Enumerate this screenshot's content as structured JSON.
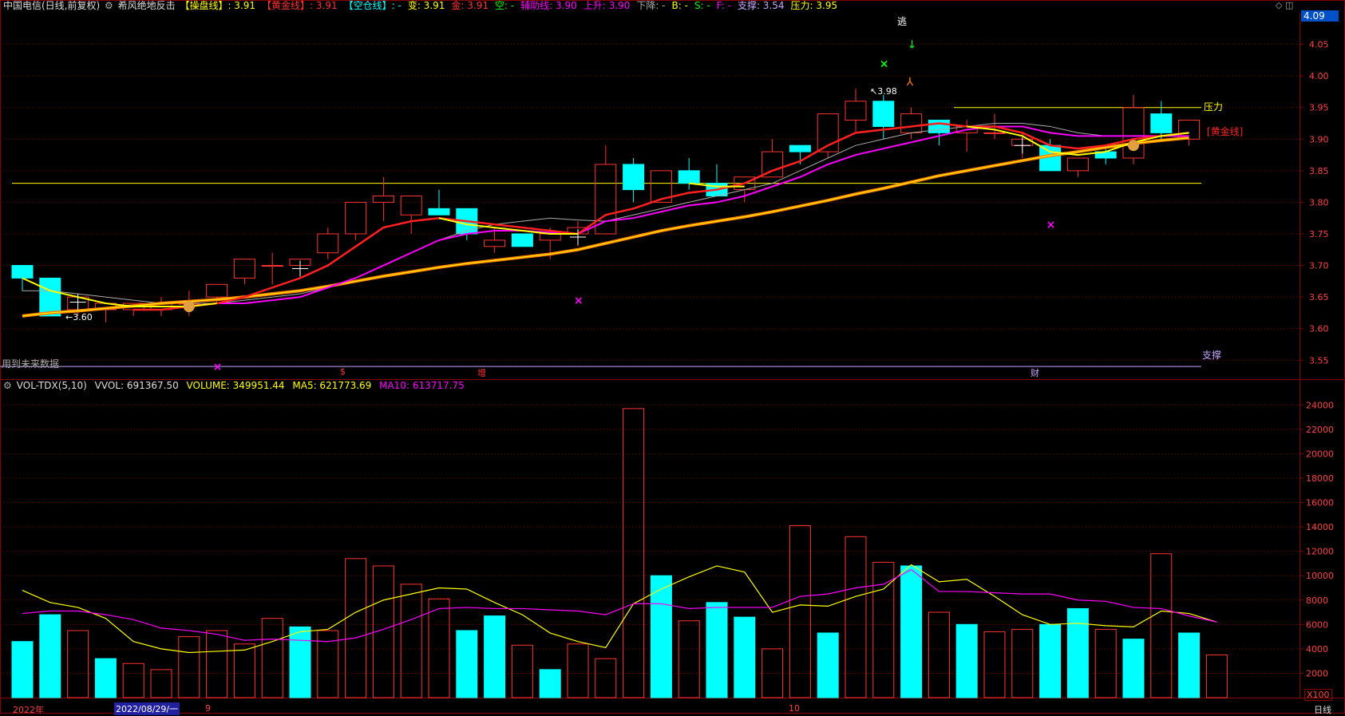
{
  "colors": {
    "up": "#ff3232",
    "down": "#00ffff",
    "grid": "#8b0000",
    "axisText": "#ff4040",
    "yellow": "#ffff00",
    "magenta": "#ff00ff",
    "red": "#ff2020",
    "orange": "#ff8000",
    "green": "#00ff00",
    "gray": "#aaaaaa",
    "white": "#ffffff",
    "lavender": "#c7a6ff"
  },
  "header": {
    "title": "中国电信(日线,前复权)",
    "indicator": "希风绝地反击",
    "items": [
      {
        "label": "【操盘线】",
        "value": ": 3.91",
        "color": "#ffff00"
      },
      {
        "label": "【黄金线】",
        "value": ": 3.91",
        "color": "#ff3030"
      },
      {
        "label": "【空仓线】",
        "value": ": -",
        "color": "#00ffff"
      },
      {
        "label": "变:",
        "value": " 3.91",
        "color": "#ffff00"
      },
      {
        "label": "金:",
        "value": " 3.91",
        "color": "#ff3030"
      },
      {
        "label": "空:",
        "value": " -",
        "color": "#00ff00"
      },
      {
        "label": "辅助线:",
        "value": " 3.90",
        "color": "#ff00ff"
      },
      {
        "label": "上升:",
        "value": " 3.90",
        "color": "#ff00ff"
      },
      {
        "label": "下降:",
        "value": " -",
        "color": "#aaaaaa"
      },
      {
        "label": "B:",
        "value": " -",
        "color": "#ffff00"
      },
      {
        "label": "S:",
        "value": " -",
        "color": "#00ff00"
      },
      {
        "label": "F:",
        "value": " -",
        "color": "#ff00ff"
      },
      {
        "label": "支撑:",
        "value": " 3.54",
        "color": "#c7a6ff"
      },
      {
        "label": "压力:",
        "value": " 3.95",
        "color": "#ffff00"
      }
    ],
    "current_price": "4.09"
  },
  "volume_header": {
    "name": "VOL-TDX(5,10)",
    "vvol": "VVOL: 691367.50",
    "volume": "VOLUME: 349951.44",
    "ma5": "MA5: 621773.69",
    "ma10": "MA10: 613717.75",
    "multiplier": "X100"
  },
  "annotations": {
    "escape": "逃",
    "pressure": "压力",
    "support": "支撑",
    "gold_label": "[黄金线]",
    "future_data": "用到未来数据",
    "high": "3.98",
    "low": "3.60",
    "markers": [
      "$",
      "增",
      "财"
    ]
  },
  "bottom_axis": {
    "year": "2022年",
    "date": "2022/08/29/一",
    "months": [
      "9",
      "10"
    ],
    "period": "日线"
  },
  "chart_data": [
    {
      "type": "candlestick",
      "title": "中国电信(日线,前复权)",
      "ylim": [
        3.52,
        4.1
      ],
      "yticks": [
        3.55,
        3.6,
        3.65,
        3.7,
        3.75,
        3.8,
        3.85,
        3.9,
        3.95,
        4.0,
        4.05
      ],
      "candles": [
        {
          "o": 3.7,
          "h": 3.7,
          "l": 3.66,
          "c": 3.68
        },
        {
          "o": 3.68,
          "h": 3.68,
          "l": 3.62,
          "c": 3.62
        },
        {
          "o": 3.63,
          "h": 3.65,
          "l": 3.62,
          "c": 3.65
        },
        {
          "o": 3.63,
          "h": 3.64,
          "l": 3.61,
          "c": 3.64
        },
        {
          "o": 3.63,
          "h": 3.64,
          "l": 3.62,
          "c": 3.64
        },
        {
          "o": 3.63,
          "h": 3.65,
          "l": 3.62,
          "c": 3.64
        },
        {
          "o": 3.64,
          "h": 3.66,
          "l": 3.62,
          "c": 3.64
        },
        {
          "o": 3.65,
          "h": 3.67,
          "l": 3.64,
          "c": 3.67
        },
        {
          "o": 3.68,
          "h": 3.71,
          "l": 3.67,
          "c": 3.71
        },
        {
          "o": 3.7,
          "h": 3.72,
          "l": 3.67,
          "c": 3.7
        },
        {
          "o": 3.7,
          "h": 3.71,
          "l": 3.69,
          "c": 3.71
        },
        {
          "o": 3.72,
          "h": 3.76,
          "l": 3.71,
          "c": 3.75
        },
        {
          "o": 3.75,
          "h": 3.8,
          "l": 3.74,
          "c": 3.8
        },
        {
          "o": 3.8,
          "h": 3.84,
          "l": 3.77,
          "c": 3.81
        },
        {
          "o": 3.78,
          "h": 3.81,
          "l": 3.75,
          "c": 3.81
        },
        {
          "o": 3.79,
          "h": 3.82,
          "l": 3.78,
          "c": 3.78
        },
        {
          "o": 3.79,
          "h": 3.79,
          "l": 3.74,
          "c": 3.75
        },
        {
          "o": 3.73,
          "h": 3.76,
          "l": 3.72,
          "c": 3.74
        },
        {
          "o": 3.75,
          "h": 3.75,
          "l": 3.73,
          "c": 3.73
        },
        {
          "o": 3.74,
          "h": 3.76,
          "l": 3.71,
          "c": 3.75
        },
        {
          "o": 3.75,
          "h": 3.77,
          "l": 3.73,
          "c": 3.76
        },
        {
          "o": 3.75,
          "h": 3.89,
          "l": 3.75,
          "c": 3.86
        },
        {
          "o": 3.86,
          "h": 3.87,
          "l": 3.8,
          "c": 3.82
        },
        {
          "o": 3.8,
          "h": 3.85,
          "l": 3.8,
          "c": 3.85
        },
        {
          "o": 3.85,
          "h": 3.87,
          "l": 3.82,
          "c": 3.83
        },
        {
          "o": 3.83,
          "h": 3.86,
          "l": 3.81,
          "c": 3.81
        },
        {
          "o": 3.82,
          "h": 3.84,
          "l": 3.8,
          "c": 3.84
        },
        {
          "o": 3.84,
          "h": 3.9,
          "l": 3.84,
          "c": 3.88
        },
        {
          "o": 3.89,
          "h": 3.89,
          "l": 3.86,
          "c": 3.88
        },
        {
          "o": 3.88,
          "h": 3.94,
          "l": 3.87,
          "c": 3.94
        },
        {
          "o": 3.93,
          "h": 3.98,
          "l": 3.91,
          "c": 3.96
        },
        {
          "o": 3.96,
          "h": 3.97,
          "l": 3.9,
          "c": 3.92
        },
        {
          "o": 3.91,
          "h": 3.95,
          "l": 3.9,
          "c": 3.94
        },
        {
          "o": 3.93,
          "h": 3.93,
          "l": 3.89,
          "c": 3.91
        },
        {
          "o": 3.91,
          "h": 3.93,
          "l": 3.88,
          "c": 3.92
        },
        {
          "o": 3.91,
          "h": 3.94,
          "l": 3.9,
          "c": 3.91
        },
        {
          "o": 3.89,
          "h": 3.91,
          "l": 3.87,
          "c": 3.9
        },
        {
          "o": 3.89,
          "h": 3.9,
          "l": 3.85,
          "c": 3.85
        },
        {
          "o": 3.85,
          "h": 3.87,
          "l": 3.84,
          "c": 3.87
        },
        {
          "o": 3.88,
          "h": 3.89,
          "l": 3.86,
          "c": 3.87
        },
        {
          "o": 3.87,
          "h": 3.97,
          "l": 3.86,
          "c": 3.95
        },
        {
          "o": 3.94,
          "h": 3.96,
          "l": 3.9,
          "c": 3.91
        },
        {
          "o": 3.9,
          "h": 3.93,
          "l": 3.89,
          "c": 3.93
        }
      ],
      "lines": {
        "gray": [
          3.66,
          3.66,
          3.655,
          3.65,
          3.645,
          3.64,
          3.64,
          3.64,
          3.645,
          3.65,
          3.655,
          3.665,
          3.68,
          3.7,
          3.72,
          3.74,
          3.755,
          3.765,
          3.77,
          3.775,
          3.772,
          3.77,
          3.78,
          3.79,
          3.8,
          3.81,
          3.82,
          3.83,
          3.85,
          3.87,
          3.89,
          3.9,
          3.91,
          3.915,
          3.92,
          3.925,
          3.925,
          3.92,
          3.91,
          3.905,
          3.905,
          3.905,
          3.905
        ],
        "yellow_green": [
          3.68,
          3.66,
          3.65,
          3.64,
          3.635,
          3.635,
          3.635,
          3.64,
          null,
          null,
          null,
          null,
          null,
          null,
          null,
          3.775,
          3.765,
          3.76,
          3.755,
          3.75,
          3.75,
          null,
          null,
          null,
          3.83,
          3.825,
          3.825,
          null,
          null,
          null,
          null,
          null,
          null,
          null,
          3.92,
          3.915,
          3.905,
          3.88,
          3.875,
          3.88,
          3.895,
          3.905,
          3.91
        ],
        "red": [
          null,
          null,
          null,
          null,
          3.63,
          3.63,
          3.635,
          3.64,
          3.65,
          3.665,
          3.68,
          3.7,
          3.73,
          3.76,
          3.77,
          3.775,
          3.77,
          3.765,
          3.76,
          3.755,
          3.75,
          3.78,
          3.79,
          3.805,
          3.815,
          3.82,
          3.83,
          3.85,
          3.865,
          3.89,
          3.91,
          3.915,
          3.92,
          3.925,
          3.92,
          3.92,
          3.91,
          3.89,
          3.885,
          3.89,
          3.9,
          3.905,
          3.91
        ],
        "magenta": [
          null,
          null,
          null,
          null,
          null,
          null,
          3.635,
          3.64,
          3.64,
          3.645,
          3.65,
          3.665,
          3.68,
          3.7,
          3.72,
          3.74,
          3.75,
          3.755,
          3.755,
          3.752,
          3.75,
          3.77,
          3.775,
          3.785,
          3.795,
          3.8,
          3.81,
          3.825,
          3.84,
          3.86,
          3.875,
          3.885,
          3.895,
          3.905,
          3.915,
          3.92,
          3.92,
          3.91,
          3.905,
          3.905,
          3.905,
          3.905,
          3.905
        ],
        "orange": [
          3.62,
          3.625,
          3.628,
          3.632,
          3.636,
          3.64,
          3.643,
          3.646,
          3.65,
          3.655,
          3.66,
          3.667,
          3.675,
          3.683,
          3.69,
          3.697,
          3.703,
          3.708,
          3.713,
          3.718,
          3.725,
          3.735,
          3.745,
          3.755,
          3.763,
          3.77,
          3.777,
          3.785,
          3.794,
          3.803,
          3.813,
          3.822,
          3.832,
          3.842,
          3.85,
          3.858,
          3.866,
          3.874,
          3.88,
          3.887,
          3.893,
          3.898,
          3.902
        ]
      },
      "hlines": {
        "resistance_long": 3.83,
        "pressure": 3.95,
        "support": 3.54
      }
    },
    {
      "type": "bar",
      "title": "VOL-TDX(5,10)",
      "ylim": [
        0,
        25000
      ],
      "yticks": [
        2000,
        4000,
        6000,
        8000,
        10000,
        12000,
        14000,
        16000,
        18000,
        20000,
        22000,
        24000
      ],
      "values": [
        4600,
        6800,
        5500,
        3200,
        2800,
        2300,
        5000,
        5500,
        4400,
        6500,
        5800,
        5500,
        11400,
        10800,
        9300,
        8100,
        5500,
        6700,
        4300,
        2300,
        4400,
        3200,
        23700,
        10000,
        6300,
        7800,
        6600,
        4000,
        14100,
        5300,
        13200,
        11100,
        10800,
        7000,
        6000,
        5400,
        5600,
        6000,
        7300,
        5600,
        4800,
        11800,
        5300,
        3500
      ],
      "up": [
        false,
        false,
        true,
        false,
        true,
        true,
        true,
        true,
        true,
        true,
        false,
        true,
        true,
        true,
        true,
        true,
        false,
        false,
        true,
        false,
        true,
        true,
        true,
        false,
        true,
        false,
        false,
        true,
        true,
        false,
        true,
        true,
        false,
        true,
        false,
        true,
        true,
        false,
        false,
        true,
        false,
        true,
        false,
        true
      ],
      "ma5": [
        8800,
        7800,
        7400,
        6500,
        4600,
        4000,
        3700,
        3800,
        3900,
        4600,
        5400,
        5600,
        7000,
        8000,
        8500,
        9000,
        8900,
        7800,
        6800,
        5300,
        4600,
        4100,
        7700,
        8900,
        9900,
        10800,
        10300,
        7000,
        7600,
        7500,
        8300,
        8900,
        10900,
        9500,
        9700,
        8300,
        6800,
        6000,
        6100,
        5900,
        5800,
        7100,
        6900,
        6200
      ],
      "ma10": [
        6900,
        7100,
        7100,
        6800,
        6400,
        5700,
        5500,
        5200,
        4700,
        4800,
        4700,
        4600,
        4900,
        5600,
        6400,
        7300,
        7400,
        7300,
        7300,
        7200,
        7100,
        6800,
        7700,
        7700,
        7300,
        7400,
        7400,
        7400,
        8300,
        8500,
        9000,
        9300,
        10500,
        8700,
        8700,
        8600,
        8500,
        8500,
        8000,
        7900,
        7400,
        7300,
        6700,
        6200
      ]
    }
  ]
}
